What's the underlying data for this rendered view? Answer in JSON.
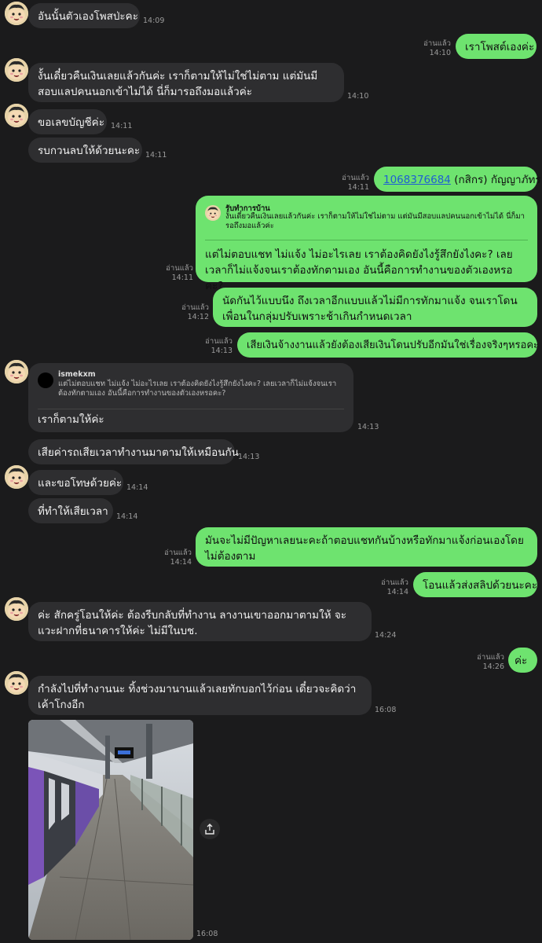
{
  "read_label": "อ่านแล้ว",
  "messages": {
    "m1": {
      "text": "อันนั้นตัวเองโพสป่ะคะ",
      "time": "14:09"
    },
    "m2": {
      "text": "เราโพสต์เองค่ะ",
      "time": "14:10"
    },
    "m3": {
      "text": "งั้นเดี๋ยวคืนเงินเลยแล้วกันค่ะ เราก็ตามให้ไม่ใช่ไม่ตาม แต่มันมีสอบแลปคนนอกเข้าไม่ได้ นี่ก็มารอถึงมอแล้วค่ะ",
      "time": "14:10"
    },
    "m4": {
      "text": "ขอเลขบัญชีค่ะ",
      "time": "14:11"
    },
    "m5": {
      "text": "รบกวนลบให้ด้วยนะคะ",
      "time": "14:11"
    },
    "m6": {
      "account": "1068376684",
      "rest": " (กสิกร) กัญญาภัทร",
      "time": "14:11"
    },
    "m7": {
      "quote_name": "รับทำการบ้าน",
      "quote_text": "งั้นเดี๋ยวคืนเงินเลยแล้วกันค่ะ เราก็ตามให้ไม่ใช่ไม่ตาม แต่มันมีสอบแลปคนนอกเข้าไม่ได้ นี่ก็มารอถึงมอแล้วค่ะ",
      "text": "แต่ไม่ตอบแชท ไม่แจ้ง ไม่อะไรเลย เราต้องคิดยังไงรู้สึกยังไงคะ? เลยเวลาก็ไม่แจ้งจนเราต้องทักตามเอง อันนี้คือการทำงานของตัวเองหรอคะ?",
      "time": "14:11"
    },
    "m8": {
      "text": "นัดกันไว้แบบนึง ถึงเวลาอีกแบบแล้วไม่มีการทักมาแจ้ง จนเราโดนเพื่อนในกลุ่มปรับเพราะช้าเกินกำหนดเวลา",
      "time": "14:12"
    },
    "m9": {
      "text": "เสียเงินจ้างงานแล้วยังต้องเสียเงินโดนปรับอีกมันใช่เรื่องจริงๆหรอคะ",
      "time": "14:13"
    },
    "m10": {
      "quote_name": "ismekxm",
      "quote_text": "แต่ไม่ตอบแชท ไม่แจ้ง ไม่อะไรเลย เราต้องคิดยังไงรู้สึกยังไงคะ? เลยเวลาก็ไม่แจ้งจนเราต้องทักตามเอง อันนี้คือการทำงานของตัวเองหรอคะ?",
      "text": "เราก็ตามให้ค่ะ",
      "time": "14:13"
    },
    "m11": {
      "text": "เสียค่ารถเสียเวลาทำงานมาตามให้เหมือนกัน",
      "time": "14:13"
    },
    "m12": {
      "text": "และขอโทษด้วยค่ะ",
      "time": "14:14"
    },
    "m13": {
      "text": "ที่ทำให้เสียเวลา",
      "time": "14:14"
    },
    "m14": {
      "text": "มันจะไม่มีปัญหาเลยนะคะถ้าตอบแชทกันบ้างหรือทักมาแจ้งก่อนเองโดยไม่ต้องตาม",
      "time": "14:14"
    },
    "m15": {
      "text": "โอนแล้วส่งสลิปด้วยนะคะ",
      "time": "14:14"
    },
    "m16": {
      "text": "ค่ะ สักครู่โอนให้ค่ะ ต้องรีบกลับที่ทำงาน ลางานเขาออกมาตามให้ จะแวะฝากที่ธนาคารให้ค่ะ ไม่มีในบช.",
      "time": "14:24"
    },
    "m17": {
      "text": "ค่ะ",
      "time": "14:26"
    },
    "m18": {
      "text": "กำลังไปที่ทำงานนะ ทิ้งช่วงมานานแล้วเลยทักบอกไว้ก่อน เดี๋ยวจะคิดว่าเค้าโกงอีก",
      "time": "16:08"
    },
    "m19": {
      "time": "16:08"
    }
  },
  "colors": {
    "background": "#1b1b1c",
    "incoming": "#2e2e30",
    "outgoing": "#6ee36f",
    "link": "#1f5fd3"
  },
  "icons": {
    "avatar": "cartoon-boy-avatar",
    "share": "share-icon"
  }
}
